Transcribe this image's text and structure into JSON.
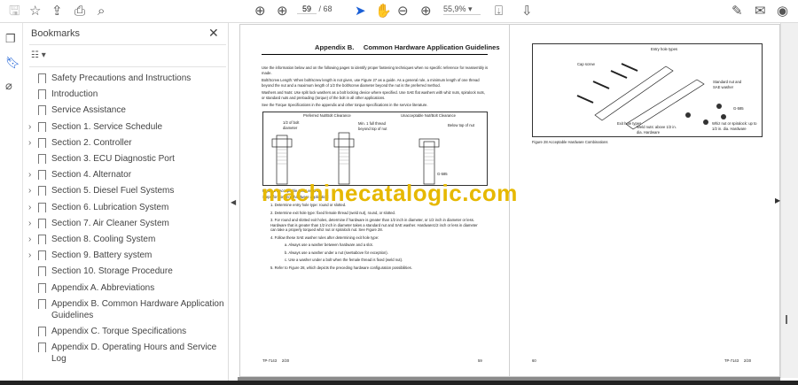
{
  "toolbar": {
    "current_page": "59",
    "total_pages": "/ 68",
    "zoom": "55,9%"
  },
  "bookmarks": {
    "title": "Bookmarks",
    "items": [
      {
        "label": "Safety Precautions and Instructions",
        "expandable": false
      },
      {
        "label": "Introduction",
        "expandable": false
      },
      {
        "label": "Service Assistance",
        "expandable": false
      },
      {
        "label": "Section 1. Service Schedule",
        "expandable": true
      },
      {
        "label": "Section 2. Controller",
        "expandable": true
      },
      {
        "label": "Section 3. ECU Diagnostic Port",
        "expandable": false
      },
      {
        "label": "Section 4. Alternator",
        "expandable": true
      },
      {
        "label": "Section 5. Diesel Fuel Systems",
        "expandable": true
      },
      {
        "label": "Section 6. Lubrication System",
        "expandable": true
      },
      {
        "label": "Section 7. Air Cleaner System",
        "expandable": true
      },
      {
        "label": "Section 8. Cooling System",
        "expandable": true
      },
      {
        "label": "Section 9. Battery system",
        "expandable": true
      },
      {
        "label": "Section 10. Storage Procedure",
        "expandable": false
      },
      {
        "label": "Appendix A. Abbreviations",
        "expandable": false
      },
      {
        "label": "Appendix B. Common Hardware Application Guidelines",
        "expandable": false
      },
      {
        "label": "Appendix C. Torque Specifications",
        "expandable": false
      },
      {
        "label": "Appendix D. Operating Hours and Service Log",
        "expandable": false
      }
    ]
  },
  "left_page": {
    "header": "Appendix B.     Common Hardware Application Guidelines",
    "paragraphs": [
      "Use the information below and on the following pages to identify proper fastening techniques when no specific reference for reassembly is made.",
      "Bolt/Screw Length: When bolt/screw length is not given, use Figure 27 as a guide. As a general rule, a minimum length of one thread beyond the nut and a maximum length of 1/2 the bolt/screw diameter beyond the nut is the preferred method.",
      "Washers and Nuts: Use split lock washers as a bolt locking device where specified. Use SAE flat washers with whiz nuts, spiralock nuts, or standard nuts and preloading (torque) of the bolt in all other applications.",
      "See the Torque Specifications in the appendix and other torque specifications in the service literature."
    ],
    "fig_labels": {
      "preferred": "Preferred Nut/Bolt Clearance",
      "unacceptable": "Unacceptable Nut/Bolt Clearance",
      "half": "1/2 of bolt diameter",
      "min": "Min. 1 full thread beyond top of nut",
      "below": "Below top of nut",
      "code": "G-585"
    },
    "caption": "Figure 27    Acceptable Bolt Lengths",
    "steps_intro": "Steps for common hardware application:",
    "steps": [
      "1.  Determine entry hole type: round or slotted.",
      "2.  Determine exit hole type: fixed female thread (weld nut), round, or slotted.",
      "3.  For round and slotted exit holes, determine if hardware is greater than 1/2 inch in diameter, or 1/2 inch in diameter or less. Hardware that is greater than 1/2 inch in diameter takes a standard nut and SAE washer. Hardware1/2 inch or less in diameter can take a properly torqued whiz nut or spiralock nut. See Figure 28.",
      "4.  Follow these SAE washer rules after determining exit hole type:"
    ],
    "substeps": [
      "a.   Always use a washer between hardware and a slot.",
      "b.   Always use a washer under a nut (see5above for exception).",
      "c.   Use a washer under a bolt when the female thread is fixed (weld nut)."
    ],
    "step5": "5.  Refer to Figure 28, which depicts the preceding hardware configuration possibilities.",
    "footer_left": "TP-7143     2/20",
    "footer_right": "59"
  },
  "right_page": {
    "fig_labels": {
      "entry": "Entry hole types",
      "cap": "Cap screw",
      "std": "Standard nut and SAE washer",
      "exit": "Exit hole types",
      "weld": "Weld nuts: above 1/2 in. dia. Hardware",
      "whiz": "Whiz nut or spiralock: up to 1/2 in. dia. Hardware",
      "code": "G-585"
    },
    "caption": "Figure 28    Acceptable Hardware Combinations",
    "footer_left": "60",
    "footer_right": "TP-7143     2/20"
  },
  "watermark": "machinecatalogic.com"
}
